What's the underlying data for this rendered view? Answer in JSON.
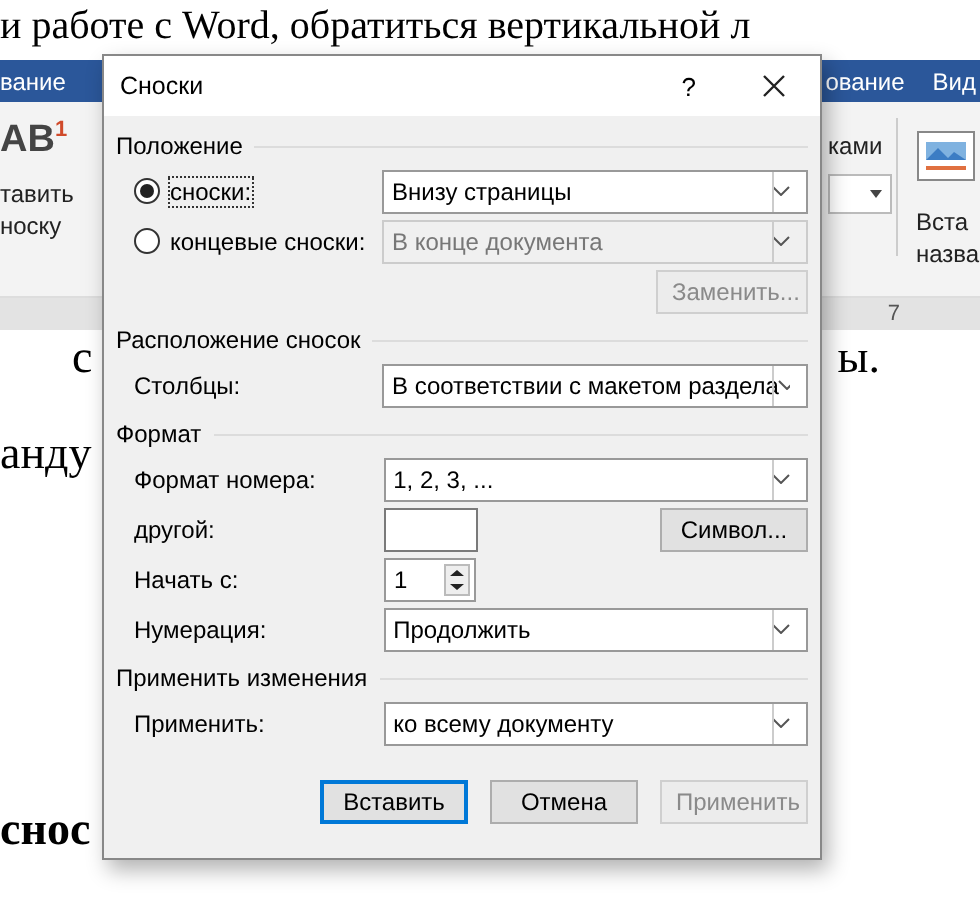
{
  "document": {
    "top_line": "и работе с Word, обратиться вертикальной л",
    "ribbon_tabs_left": [
      "вание"
    ],
    "ribbon_tabs_right": [
      "ование",
      "Вид"
    ],
    "ribbon_left": {
      "icon_text": "AB$^{1}$",
      "labels": [
        "тавить",
        "носку"
      ]
    },
    "ribbon_right": {
      "group_label": "ками",
      "labels": [
        "Вста",
        "назва"
      ]
    },
    "ruler_mark": "7",
    "lines": [
      {
        "left": "с",
        "right": "ы.",
        "bold": false
      },
      {
        "left": "анду",
        "bold": false
      },
      {
        "left": "снос",
        "bold": true
      }
    ]
  },
  "dialog": {
    "title": "Сноски",
    "help": "?",
    "sections": [
      {
        "title": "Положение",
        "rows": [
          {
            "kind": "radio",
            "label": "сноски:",
            "selected": true,
            "value": "Внизу страницы",
            "disabled": false
          },
          {
            "kind": "radio",
            "label": "концевые сноски:",
            "selected": false,
            "value": "В конце документа",
            "disabled": true
          },
          {
            "kind": "button",
            "label": "Заменить...",
            "disabled": true
          }
        ]
      },
      {
        "title": "Расположение сносок",
        "rows": [
          {
            "kind": "select",
            "label": "Столбцы:",
            "value": "В соответствии с макетом раздела",
            "disabled": false
          }
        ]
      },
      {
        "title": "Формат",
        "rows": [
          {
            "kind": "select",
            "label": "Формат номера:",
            "value": "1, 2, 3, ...",
            "disabled": false
          },
          {
            "kind": "text",
            "label": "другой:",
            "button": "Символ...",
            "disabled": false
          },
          {
            "kind": "spinner",
            "label": "Начать с:",
            "value": "1",
            "disabled": false
          },
          {
            "kind": "select",
            "label": "Нумерация:",
            "value": "Продолжить",
            "disabled": false
          }
        ]
      },
      {
        "title": "Применить изменения",
        "rows": [
          {
            "kind": "select",
            "label": "Применить:",
            "value": "ко всему документу",
            "disabled": false
          }
        ]
      }
    ],
    "buttons": [
      {
        "label": "Вставить",
        "default": true,
        "disabled": false
      },
      {
        "label": "Отмена",
        "default": false,
        "disabled": false
      },
      {
        "label": "Применить",
        "default": false,
        "disabled": true
      }
    ]
  }
}
